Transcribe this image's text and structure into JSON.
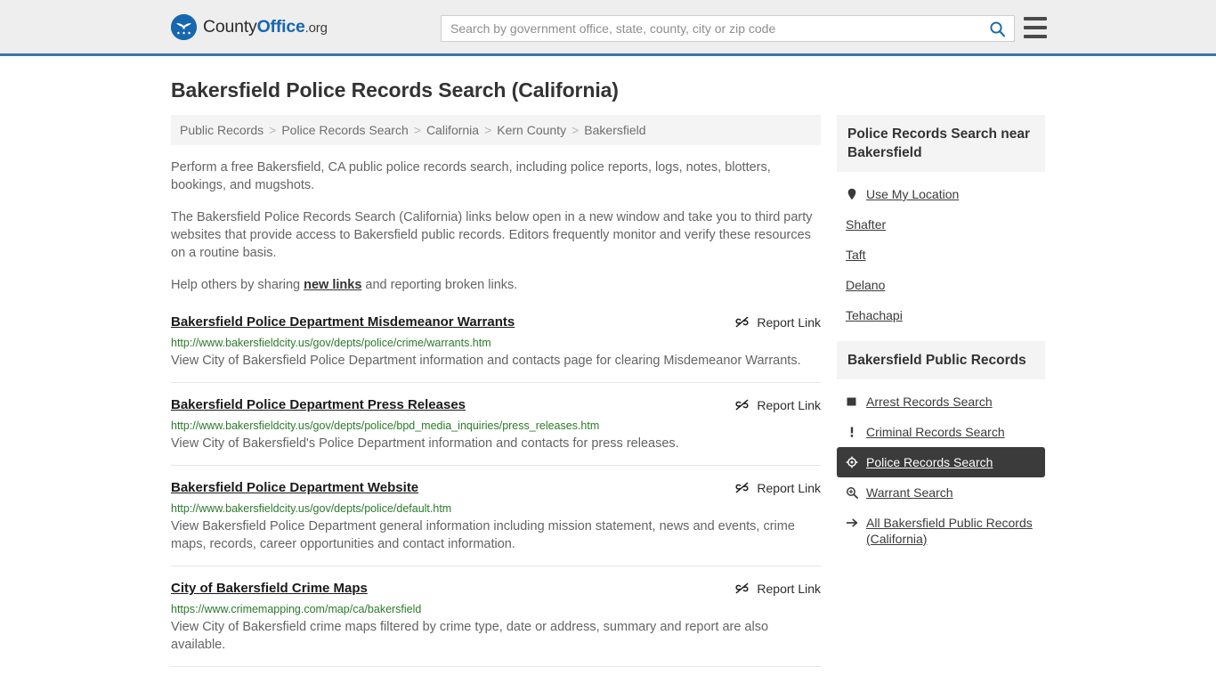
{
  "header": {
    "brand": {
      "part1": "County",
      "part2": "Office",
      "tld": ".org",
      "icon": "countyoffice-eagle-logo"
    },
    "search": {
      "placeholder": "Search by government office, state, county, city or zip code",
      "value": ""
    },
    "search_icon": "search-icon",
    "menu_icon": "hamburger-menu-icon"
  },
  "page": {
    "title": "Bakersfield Police Records Search (California)",
    "breadcrumb": [
      "Public Records",
      "Police Records Search",
      "California",
      "Kern County",
      "Bakersfield"
    ],
    "breadcrumb_separator": ">",
    "intro": [
      "Perform a free Bakersfield, CA public police records search, including police reports, logs, notes, blotters, bookings, and mugshots.",
      "The Bakersfield Police Records Search (California) links below open in a new window and take you to third party websites that provide access to Bakersfield public records. Editors frequently monitor and verify these resources on a routine basis."
    ],
    "help_line": {
      "before": "Help others by sharing ",
      "link": "new links",
      "after": " and reporting broken links."
    }
  },
  "results": {
    "report_label": "Report Link",
    "report_icon": "broken-link-icon",
    "items": [
      {
        "title": "Bakersfield Police Department Misdemeanor Warrants",
        "url": "http://www.bakersfieldcity.us/gov/depts/police/crime/warrants.htm",
        "desc": "View City of Bakersfield Police Department information and contacts page for clearing Misdemeanor Warrants."
      },
      {
        "title": "Bakersfield Police Department Press Releases",
        "url": "http://www.bakersfieldcity.us/gov/depts/police/bpd_media_inquiries/press_releases.htm",
        "desc": "View City of Bakersfield's Police Department information and contacts for press releases."
      },
      {
        "title": "Bakersfield Police Department Website",
        "url": "http://www.bakersfieldcity.us/gov/depts/police/default.htm",
        "desc": "View Bakersfield Police Department general information including mission statement, news and events, crime maps, records, career opportunities and contact information."
      },
      {
        "title": "City of Bakersfield Crime Maps",
        "url": "https://www.crimemapping.com/map/ca/bakersfield",
        "desc": "View City of Bakersfield crime maps filtered by crime type, date or address, summary and report are also available."
      }
    ]
  },
  "sidebar": {
    "nearby": {
      "heading": "Police Records Search near Bakersfield",
      "items": [
        {
          "label": "Use My Location",
          "icon": "map-pin-icon"
        },
        {
          "label": "Shafter",
          "icon": ""
        },
        {
          "label": "Taft",
          "icon": ""
        },
        {
          "label": "Delano",
          "icon": ""
        },
        {
          "label": "Tehachapi",
          "icon": ""
        }
      ]
    },
    "public_records": {
      "heading": "Bakersfield Public Records",
      "items": [
        {
          "label": "Arrest Records Search",
          "icon": "square-icon",
          "active": false
        },
        {
          "label": "Criminal Records Search",
          "icon": "exclamation-icon",
          "active": false
        },
        {
          "label": "Police Records Search",
          "icon": "crosshair-icon",
          "active": true
        },
        {
          "label": "Warrant Search",
          "icon": "magnifier-plus-icon",
          "active": false
        },
        {
          "label": "All Bakersfield Public Records (California)",
          "icon": "arrow-right-icon",
          "active": false
        }
      ]
    }
  },
  "colors": {
    "brand_blue": "#1767ae",
    "header_bg": "#eeeeee",
    "header_border": "#3b76ab",
    "url_green": "#2c7a2c",
    "active_bg": "#3b3b3b",
    "panel_bg": "#f4f4f4"
  }
}
